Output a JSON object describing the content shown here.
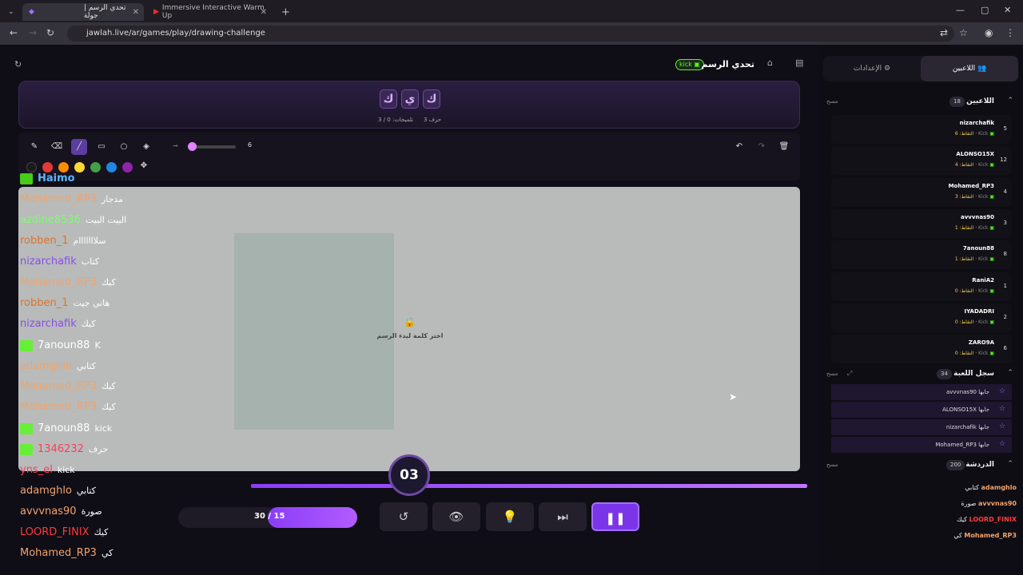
{
  "browser": {
    "tab1_title": "تحدي الرسم | جولة",
    "tab2_title": "Immersive Interactive Warm Up",
    "url": "jawlah.live/ar/games/play/drawing-challenge",
    "new_tab": "+",
    "close_glyph": "✕",
    "minimize": "—",
    "maximize": "▢",
    "close": "✕"
  },
  "game": {
    "title": "تحدي الرسم",
    "platform_badge": "kick",
    "letters": [
      "ك",
      "ي",
      "ك"
    ],
    "letter_count": "3 حرف",
    "hints": "تلميحات: 0 / 3",
    "brush_size": "6",
    "brush_size_fraction": 0.1,
    "canvas_message": "اختر كلمة لبدء الرسم",
    "timer": "03",
    "timer_progress": 1.0,
    "round_label": "30 / 15",
    "round_fraction": 0.5
  },
  "colors": {
    "accent": "#8a3df8",
    "swatches": [
      "#1b1b1b",
      "#e53935",
      "#fb8c00",
      "#fdd835",
      "#43a047",
      "#1e88e5",
      "#8e24aa"
    ]
  },
  "overlay_chat": [
    {
      "user": "Haimo",
      "msg": "",
      "color": "#5ab4ff",
      "badge": true
    },
    {
      "user": "Mohamed_RP3",
      "msg": "مدجار",
      "color": "#f2a36b"
    },
    {
      "user": "azdine8536",
      "msg": "البيت البيت",
      "color": "#7dff6e"
    },
    {
      "user": "robben_1",
      "msg": "سلااااااام",
      "color": "#e0722a"
    },
    {
      "user": "nizarchafik",
      "msg": "كتاب",
      "color": "#8a4de8"
    },
    {
      "user": "Mohamed_RP3",
      "msg": "كيك",
      "color": "#f2a36b"
    },
    {
      "user": "robben_1",
      "msg": "هاني جيت",
      "color": "#e0722a"
    },
    {
      "user": "nizarchafik",
      "msg": "كيك",
      "color": "#8a4de8"
    },
    {
      "user": "7anoun88",
      "msg": "K",
      "color": "#ffffff",
      "badge": true
    },
    {
      "user": "adamghlo",
      "msg": "كتابي",
      "color": "#f2a36b"
    },
    {
      "user": "Mohamed_RP3",
      "msg": "كيك",
      "color": "#f2a36b"
    },
    {
      "user": "Mohamed_RP3",
      "msg": "كيك",
      "color": "#f2a36b"
    },
    {
      "user": "7anoun88",
      "msg": "kick",
      "color": "#ffffff",
      "badge": true
    },
    {
      "user": "1346232",
      "msg": "حرف",
      "color": "#ff3b5c",
      "badge": true
    },
    {
      "user": "yns_el",
      "msg": "kick",
      "color": "#ff3b5c"
    },
    {
      "user": "adamghlo",
      "msg": "كتابي",
      "color": "#f2a36b"
    },
    {
      "user": "avvvnas90",
      "msg": "صورة",
      "color": "#f2a36b"
    },
    {
      "user": "LOORD_FINIX",
      "msg": "كيك",
      "color": "#ff3b3b"
    },
    {
      "user": "Mohamed_RP3",
      "msg": "كي",
      "color": "#f2a36b"
    }
  ],
  "panel": {
    "tab_players": "اللاعبين",
    "tab_settings": "الإعدادات",
    "players_section": "اللاعبين",
    "players_count": "18",
    "clear": "مسح",
    "players": [
      {
        "name": "nizarchafik",
        "points": "النقاط: 6",
        "rank": "5"
      },
      {
        "name": "ALONSO15X",
        "points": "النقاط: 4",
        "rank": "12"
      },
      {
        "name": "Mohamed_RP3",
        "points": "النقاط: 3",
        "rank": "4"
      },
      {
        "name": "avvvnas90",
        "points": "النقاط: 1",
        "rank": "3"
      },
      {
        "name": "7anoun88",
        "points": "النقاط: 1",
        "rank": "8"
      },
      {
        "name": "RaniA2",
        "points": "النقاط: 0",
        "rank": "1"
      },
      {
        "name": "IYADADRI",
        "points": "النقاط: 0",
        "rank": "2"
      },
      {
        "name": "ZARO9A",
        "points": "النقاط: 0",
        "rank": "6"
      }
    ],
    "player_platform": "Kick",
    "log_section": "سجل اللعبة",
    "log_count": "34",
    "log": [
      "avvvnas90 جابها",
      "ALONSO15X جابها",
      "nizarchafik جابها",
      "Mohamed_RP3 جابها"
    ],
    "chat_section": "الدردشة",
    "chat_count": "200",
    "chat": [
      {
        "user": "adamghlo",
        "msg": "كتابي",
        "color": "#f2a36b"
      },
      {
        "user": "avvvnas90",
        "msg": "صورة",
        "color": "#f2a36b"
      },
      {
        "user": "LOORD_FINIX",
        "msg": "كيك",
        "color": "#ff3b3b"
      },
      {
        "user": "Mohamed_RP3",
        "msg": "كي",
        "color": "#f2a36b"
      }
    ]
  }
}
